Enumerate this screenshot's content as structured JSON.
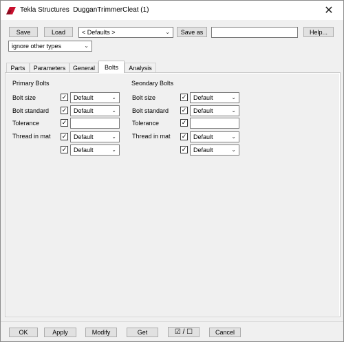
{
  "window": {
    "app_name": "Tekla Structures",
    "document_title": "DugganTrimmerCleat (1)",
    "close_glyph": "✕"
  },
  "toolbar": {
    "save_label": "Save",
    "load_label": "Load",
    "preset_selected": "< Defaults >",
    "save_as_label": "Save as",
    "save_as_value": "",
    "help_label": "Help...",
    "filter_selected": "ignore other types"
  },
  "tabs": [
    {
      "label": "Parts"
    },
    {
      "label": "Parameters"
    },
    {
      "label": "General"
    },
    {
      "label": "Bolts",
      "active": true
    },
    {
      "label": "Analysis"
    }
  ],
  "primary": {
    "heading": "Primary Bolts",
    "bolt_size_label": "Bolt size",
    "bolt_size_value": "Default",
    "bolt_standard_label": "Bolt standard",
    "bolt_standard_value": "Default",
    "tolerance_label": "Tolerance",
    "tolerance_value": "",
    "thread_label": "Thread in mat",
    "thread_value": "Default",
    "extra_value": "Default"
  },
  "secondary": {
    "heading": "Seondary Bolts",
    "bolt_size_label": "Bolt size",
    "bolt_size_value": "Default",
    "bolt_standard_label": "Bolt standard",
    "bolt_standard_value": "Default",
    "tolerance_label": "Tolerance",
    "tolerance_value": "",
    "thread_label": "Thread in mat",
    "thread_value": "Default",
    "extra_value": "Default"
  },
  "check_mark": "✓",
  "footer": {
    "ok_label": "OK",
    "apply_label": "Apply",
    "modify_label": "Modify",
    "get_label": "Get",
    "toggle_label": "☑ / ☐",
    "cancel_label": "Cancel"
  },
  "colors": {
    "icon_red": "#c8102e",
    "tab_active_bg": "#ffffff",
    "window_bg": "#f0f0f0"
  }
}
